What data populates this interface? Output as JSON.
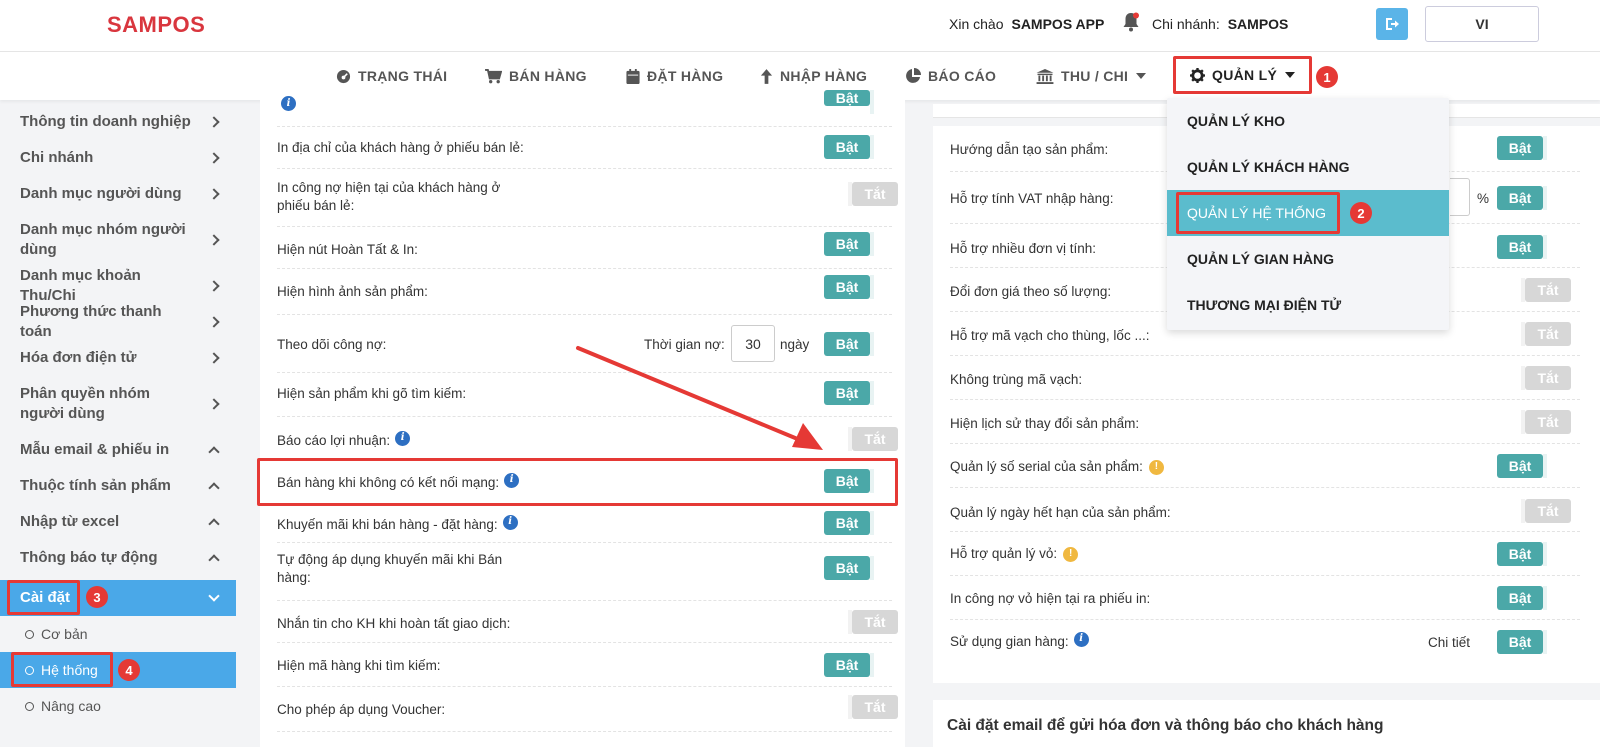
{
  "header": {
    "logo": "SAMPOS",
    "greeting": "Xin chào",
    "user": "SAMPOS APP",
    "branch_label": "Chi nhánh:",
    "branch_value": "SAMPOS",
    "lang": "VI"
  },
  "nav": {
    "items": [
      "TRẠNG THÁI",
      "BÁN HÀNG",
      "ĐẶT HÀNG",
      "NHẬP HÀNG",
      "BÁO CÁO",
      "THU / CHI",
      "QUẢN LÝ"
    ],
    "active_badge": "1"
  },
  "dropdown": {
    "items": [
      "QUẢN LÝ KHO",
      "QUẢN LÝ KHÁCH HÀNG",
      "QUẢN LÝ HỆ THỐNG",
      "QUẢN LÝ GIAN HÀNG",
      "THƯƠNG MẠI ĐIỆN TỬ"
    ],
    "active_badge": "2"
  },
  "sidebar": {
    "items": [
      "Thông tin doanh nghiệp",
      "Chi nhánh",
      "Danh mục người dùng",
      "Danh mục nhóm người dùng",
      "Danh mục khoản Thu/Chi",
      "Phương thức thanh toán",
      "Hóa đơn điện tử",
      "Phân quyền nhóm người dùng",
      "Mẫu email & phiếu in",
      "Thuộc tính sản phẩm",
      "Nhập từ excel",
      "Thông báo tự động",
      "Cài đặt"
    ],
    "active_badge": "3",
    "sub_items": [
      "Cơ bản",
      "Hệ thống",
      "Nâng cao"
    ],
    "sub_badge": "4"
  },
  "toggle": {
    "on": "Bật",
    "off": "Tắt"
  },
  "left_panel": {
    "rows": [
      {
        "text": "In địa chỉ của khách hàng ở phiếu bán lẻ:",
        "state": "on"
      },
      {
        "text": "In công nợ hiện tại của khách hàng ở phiếu bán lẻ:",
        "state": "off"
      },
      {
        "text": "Hiện nút Hoàn Tất & In:",
        "state": "on"
      },
      {
        "text": "Hiện hình ảnh sản phẩm:",
        "state": "on"
      },
      {
        "text": "Theo dõi công nợ:",
        "state": "on"
      },
      {
        "text": "Hiện sản phẩm khi gõ tìm kiếm:",
        "state": "on"
      },
      {
        "text": "Báo cáo lợi nhuận:",
        "state": "off"
      },
      {
        "text": "Bán hàng khi không có kết nối mạng:",
        "state": "on"
      },
      {
        "text": "Khuyến mãi khi bán hàng - đặt hàng:",
        "state": "on"
      },
      {
        "text": "Tự động áp dụng khuyến mãi khi Bán hàng:",
        "state": "on"
      },
      {
        "text": "Nhắn tin cho KH khi hoàn tất giao dịch:",
        "state": "off"
      },
      {
        "text": "Hiện mã hàng khi tìm kiếm:",
        "state": "on"
      },
      {
        "text": "Cho phép áp dụng Voucher:",
        "state": "off"
      }
    ],
    "debt_label": "Thời gian nợ:",
    "debt_value": "30",
    "debt_unit": "ngày"
  },
  "right_panel": {
    "rows": [
      {
        "text": "Hướng dẫn tạo sản phẩm:",
        "state": "on"
      },
      {
        "text": "Hỗ trợ tính VAT nhập hàng:",
        "state": "on"
      },
      {
        "text": "Hỗ trợ nhiều đơn vị tính:",
        "state": "on"
      },
      {
        "text": "Đổi đơn giá theo số lượng:",
        "state": "off"
      },
      {
        "text": "Hỗ trợ mã vạch cho thùng, lốc ...:",
        "state": "off"
      },
      {
        "text": "Không trùng mã vạch:",
        "state": "off"
      },
      {
        "text": "Hiện lịch sử thay đổi sản phẩm:",
        "state": "off"
      },
      {
        "text": "Quản lý số serial của sản phẩm:",
        "state": "on"
      },
      {
        "text": "Quản lý ngày hết hạn của sản phẩm:",
        "state": "off"
      },
      {
        "text": "Hỗ trợ quản lý vỏ:",
        "state": "on"
      },
      {
        "text": "In công nợ vỏ hiện tại ra phiếu in:",
        "state": "on"
      },
      {
        "text": "Sử dụng gian hàng:",
        "state": "on"
      }
    ],
    "percent": "%",
    "detail_link": "Chi tiết",
    "email_title": "Cài đặt email để gửi hóa đơn và thông báo cho khách hàng"
  },
  "colors": {
    "brand": "#d9363e",
    "accent": "#4aa8e8",
    "toggle_on": "#4ba8a8",
    "toggle_off": "#d7d7d7",
    "annotation": "#e53935"
  }
}
